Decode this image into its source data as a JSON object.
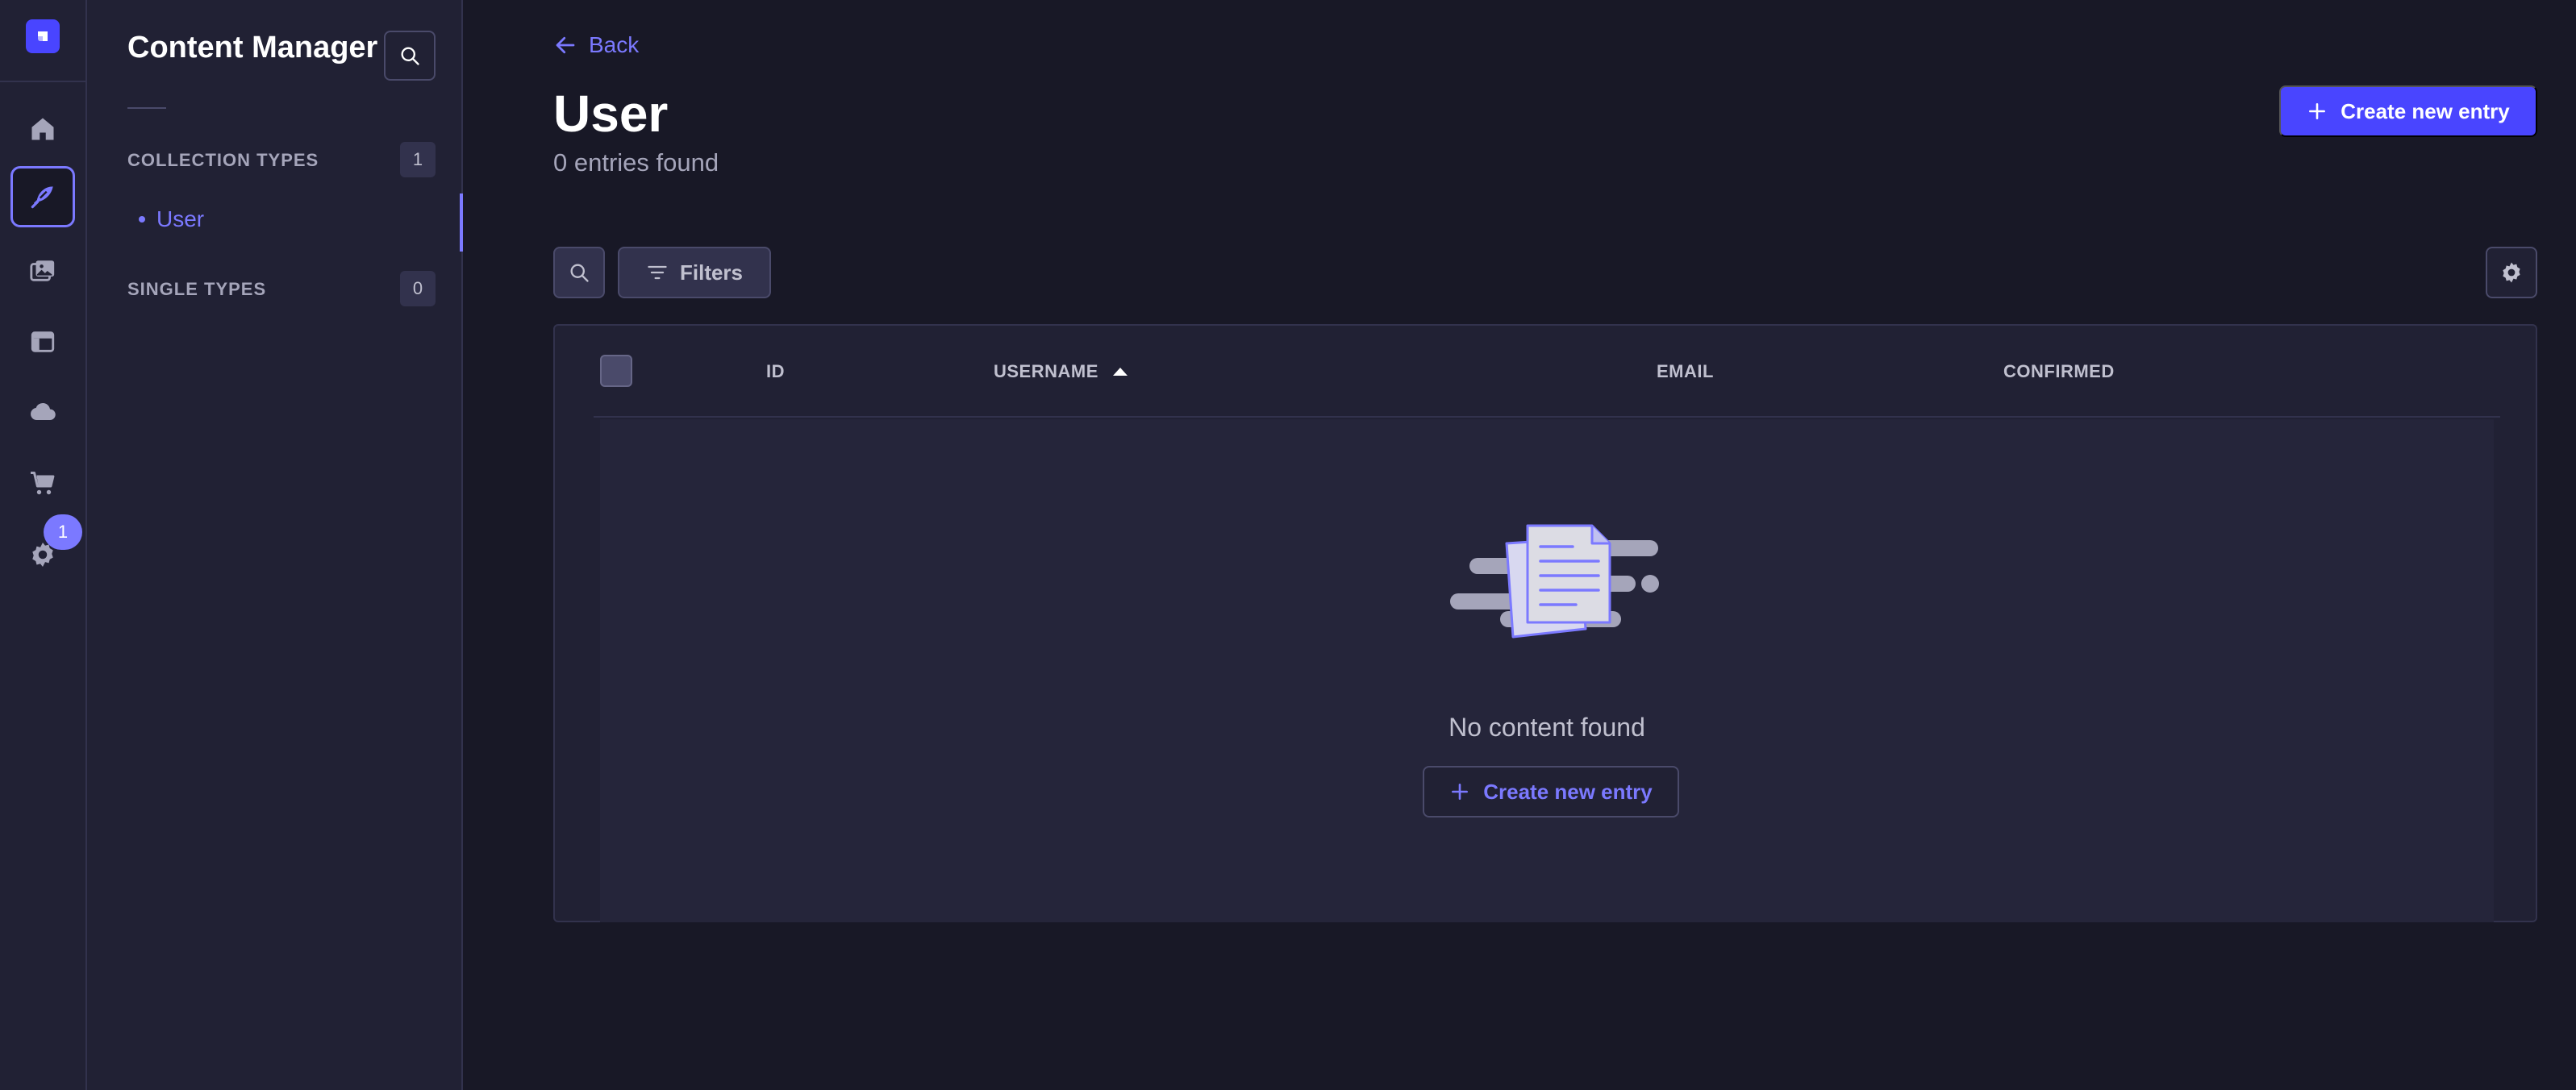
{
  "rail": {
    "badge_count": "1",
    "items": [
      {
        "icon": "home-icon"
      },
      {
        "icon": "feather-icon",
        "active": true
      },
      {
        "icon": "media-library-icon"
      },
      {
        "icon": "layout-icon"
      },
      {
        "icon": "cloud-icon"
      },
      {
        "icon": "cart-icon"
      },
      {
        "icon": "gear-icon"
      }
    ]
  },
  "sidebar": {
    "title": "Content Manager",
    "collection_types_label": "COLLECTION TYPES",
    "collection_types_count": "1",
    "collection_items": [
      {
        "label": "User"
      }
    ],
    "single_types_label": "SINGLE TYPES",
    "single_types_count": "0"
  },
  "header": {
    "back_label": "Back",
    "title": "User",
    "subtitle": "0 entries found",
    "create_label": "Create new entry"
  },
  "toolbar": {
    "filters_label": "Filters"
  },
  "table": {
    "columns": [
      "ID",
      "USERNAME",
      "EMAIL",
      "CONFIRMED"
    ],
    "sort_column": "USERNAME",
    "sort_direction": "asc"
  },
  "empty_state": {
    "message": "No content found",
    "create_label": "Create new entry"
  },
  "colors": {
    "accent": "#4945ff",
    "accent_light": "#7b79ff",
    "background": "#181826",
    "panel": "#212134"
  }
}
